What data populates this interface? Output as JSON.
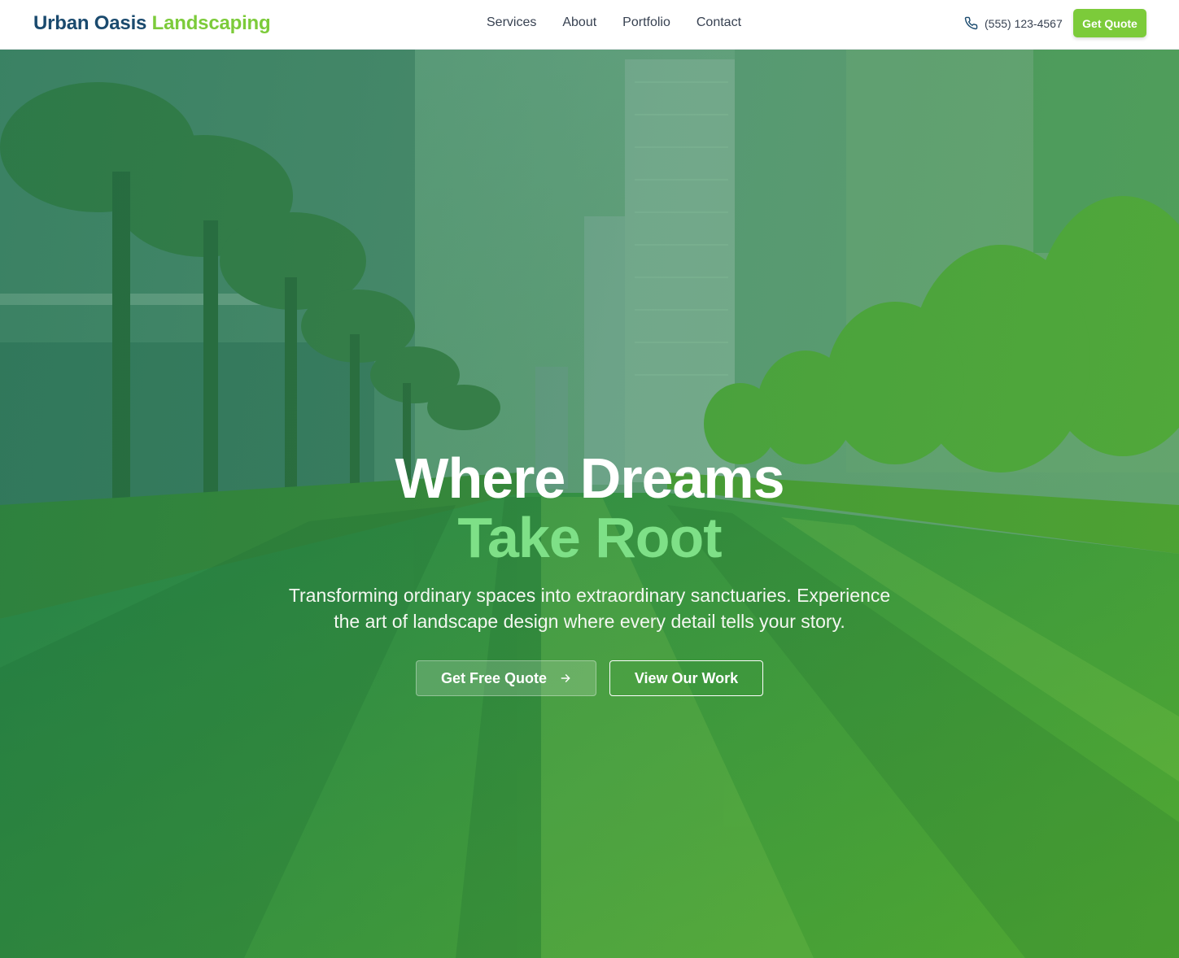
{
  "header": {
    "logo_primary": "Urban Oasis",
    "logo_accent": "Landscaping",
    "nav": [
      "Services",
      "About",
      "Portfolio",
      "Contact"
    ],
    "phone": "(555) 123-4567",
    "phone_icon": "phone-icon",
    "cta": "Get Quote"
  },
  "hero": {
    "title_line1": "Where Dreams",
    "title_line2": "Take Root",
    "subtitle_line1": "Transforming ordinary spaces into extraordinary sanctuaries. Experience",
    "subtitle_line2": "the art of landscape design where every detail tells your story.",
    "primary_button": "Get Free Quote",
    "primary_button_icon": "arrow-right-icon",
    "secondary_button": "View Our Work",
    "background_image": "urban-park-lawn-with-palm-trees-and-highrise-buildings"
  },
  "colors": {
    "brand_dark": "#1a4a6e",
    "brand_green": "#7ccb3a",
    "title_accent": "#7ee087"
  }
}
